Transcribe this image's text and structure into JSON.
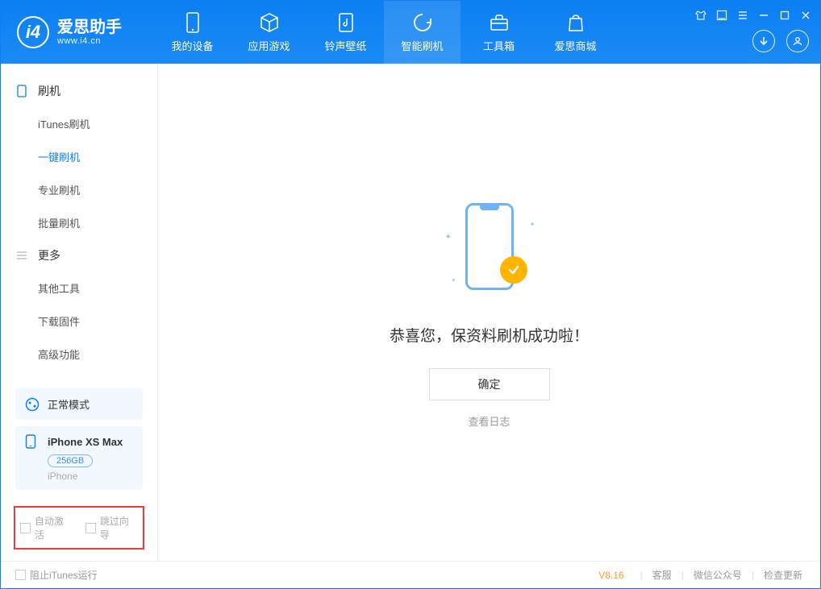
{
  "logo": {
    "title": "爱思助手",
    "subtitle": "www.i4.cn"
  },
  "nav": [
    {
      "label": "我的设备"
    },
    {
      "label": "应用游戏"
    },
    {
      "label": "铃声壁纸"
    },
    {
      "label": "智能刷机"
    },
    {
      "label": "工具箱"
    },
    {
      "label": "爱思商城"
    }
  ],
  "sidebar": {
    "section1": {
      "title": "刷机",
      "items": [
        "iTunes刷机",
        "一键刷机",
        "专业刷机",
        "批量刷机"
      ]
    },
    "section2": {
      "title": "更多",
      "items": [
        "其他工具",
        "下载固件",
        "高级功能"
      ]
    },
    "mode": "正常模式",
    "device": {
      "name": "iPhone XS Max",
      "storage": "256GB",
      "type": "iPhone"
    },
    "checkboxes": {
      "auto_activate": "自动激活",
      "skip_guide": "跳过向导"
    }
  },
  "main": {
    "success_text": "恭喜您，保资料刷机成功啦！",
    "ok_button": "确定",
    "view_log": "查看日志"
  },
  "statusbar": {
    "block_itunes": "阻止iTunes运行",
    "version": "V8.16",
    "links": [
      "客服",
      "微信公众号",
      "检查更新"
    ]
  }
}
